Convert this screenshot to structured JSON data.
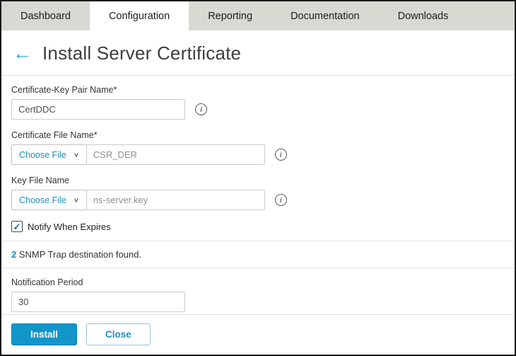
{
  "tabs": [
    {
      "label": "Dashboard"
    },
    {
      "label": "Configuration"
    },
    {
      "label": "Reporting"
    },
    {
      "label": "Documentation"
    },
    {
      "label": "Downloads"
    }
  ],
  "header": {
    "title": "Install Server Certificate"
  },
  "icons": {
    "back_arrow": "←",
    "chevron_down": "∨",
    "info": "i",
    "checkmark": "✓"
  },
  "form": {
    "cert_key_pair_name": {
      "label": "Certificate-Key Pair Name*",
      "value": "CertDDC"
    },
    "certificate_file": {
      "label": "Certificate File Name*",
      "choose_button": "Choose File",
      "value": "CSR_DER"
    },
    "key_file": {
      "label": "Key File Name",
      "choose_button": "Choose File",
      "value": "ns-server.key"
    },
    "notify_when_expires": {
      "label": "Notify When Expires",
      "checked": true
    },
    "snmp_message": {
      "count": "2",
      "text": "SNMP Trap destination found."
    },
    "notification_period": {
      "label": "Notification Period",
      "value": "30"
    }
  },
  "footer": {
    "install_label": "Install",
    "close_label": "Close"
  },
  "colors": {
    "accent_teal": "#1b8fc0",
    "tab_bar_bg": "#d9d9d3",
    "install_button_bg": "#1295c9"
  }
}
